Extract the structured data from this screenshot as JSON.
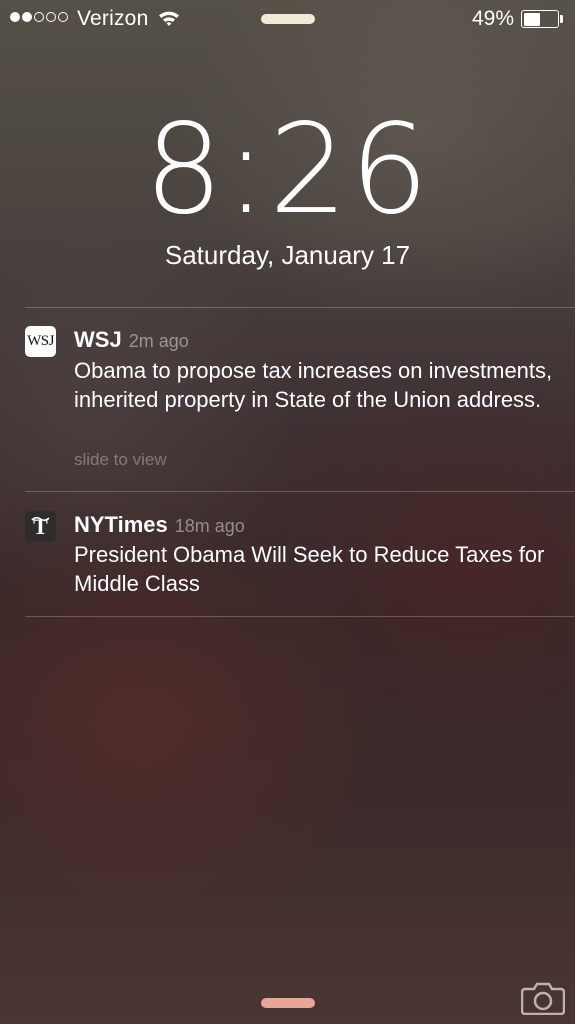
{
  "status_bar": {
    "signal_bars": 2,
    "signal_total": 5,
    "carrier": "Verizon",
    "wifi_icon": "wifi-icon",
    "battery_percent_label": "49%",
    "battery_level": 0.49
  },
  "lock_screen": {
    "time": "8:26",
    "date": "Saturday, January 17"
  },
  "notifications": [
    {
      "app": "WSJ",
      "icon_text": "WSJ",
      "time": "2m ago",
      "message": "Obama to propose tax increases on investments, inherited property in State of the Union address.",
      "hint": "slide to view"
    },
    {
      "app": "NYTimes",
      "icon": "nyt-logo-icon",
      "time": "18m ago",
      "message": "President Obama Will Seek to Reduce Taxes for Middle Class"
    }
  ],
  "colors": {
    "text": "#ffffff",
    "grabber_top": "#f0ead6",
    "grabber_bottom": "#e6a79a"
  }
}
